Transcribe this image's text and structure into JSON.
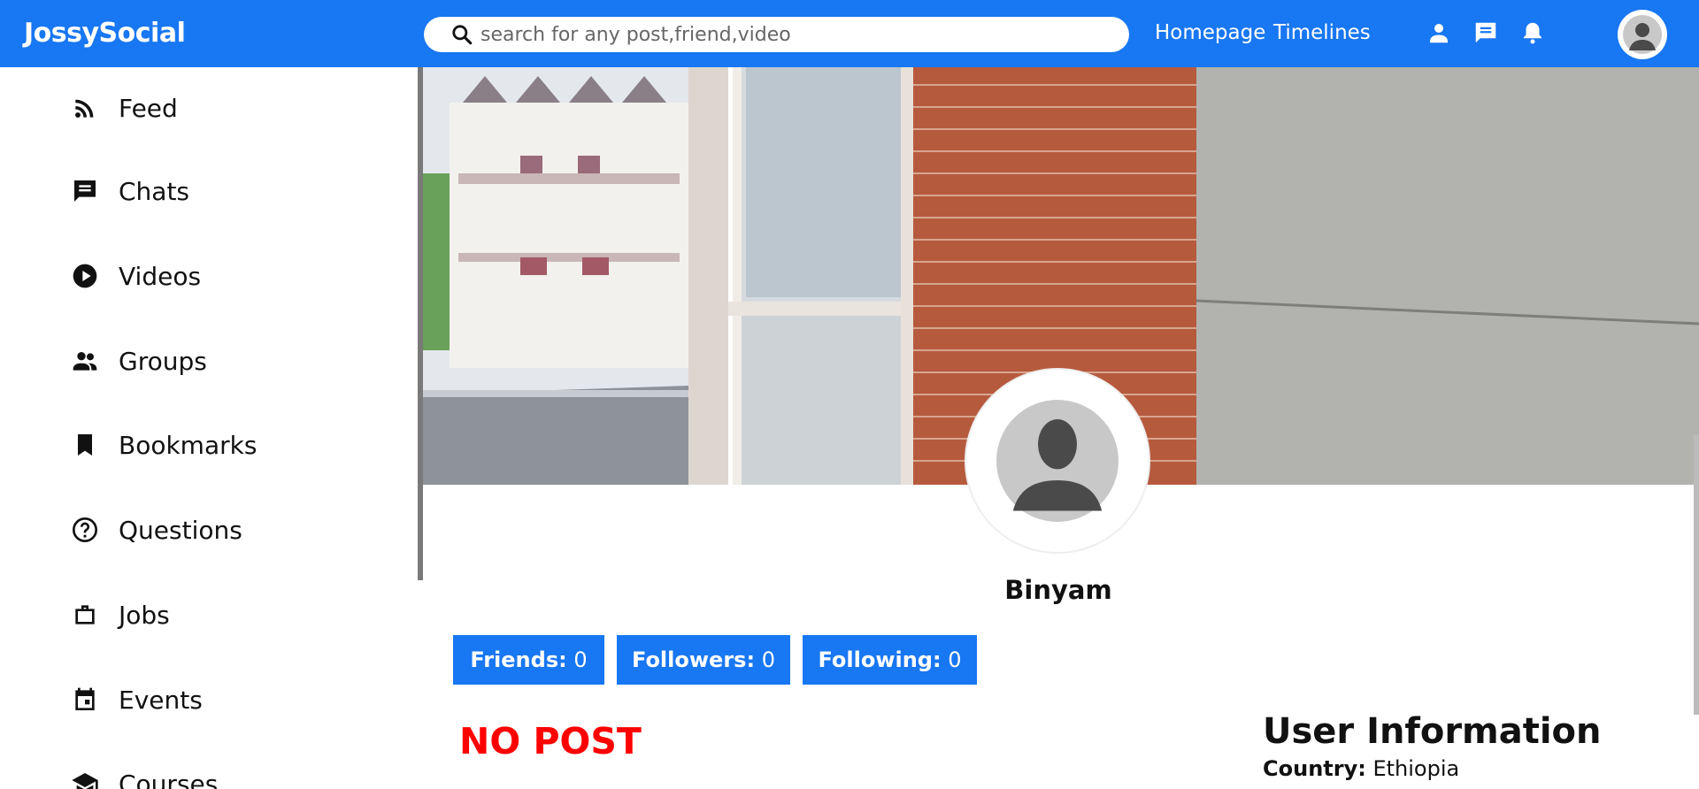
{
  "app": {
    "title": "JossySocial"
  },
  "search": {
    "placeholder": "search for any post,friend,video"
  },
  "nav": {
    "links": [
      "Homepage",
      "Timelines"
    ]
  },
  "sidebar": {
    "items": [
      {
        "label": "Feed",
        "icon": "rss-feed-icon"
      },
      {
        "label": "Chats",
        "icon": "chat-icon"
      },
      {
        "label": "Videos",
        "icon": "play-circle-icon"
      },
      {
        "label": "Groups",
        "icon": "group-icon"
      },
      {
        "label": "Bookmarks",
        "icon": "bookmark-icon"
      },
      {
        "label": "Questions",
        "icon": "help-circle-icon"
      },
      {
        "label": "Jobs",
        "icon": "briefcase-icon"
      },
      {
        "label": "Events",
        "icon": "calendar-event-icon"
      },
      {
        "label": "Courses",
        "icon": "school-icon"
      }
    ]
  },
  "profile": {
    "name": "Binyam",
    "stats": [
      {
        "label": "Friends:",
        "value": "0"
      },
      {
        "label": "Followers:",
        "value": "0"
      },
      {
        "label": "Following:",
        "value": "0"
      }
    ],
    "empty_posts": "NO POST"
  },
  "user_info": {
    "title": "User Information",
    "country_label": "Country:",
    "country_value": "Ethiopia"
  },
  "colors": {
    "brand": "#1877f2",
    "empty_text": "#ff0000"
  }
}
